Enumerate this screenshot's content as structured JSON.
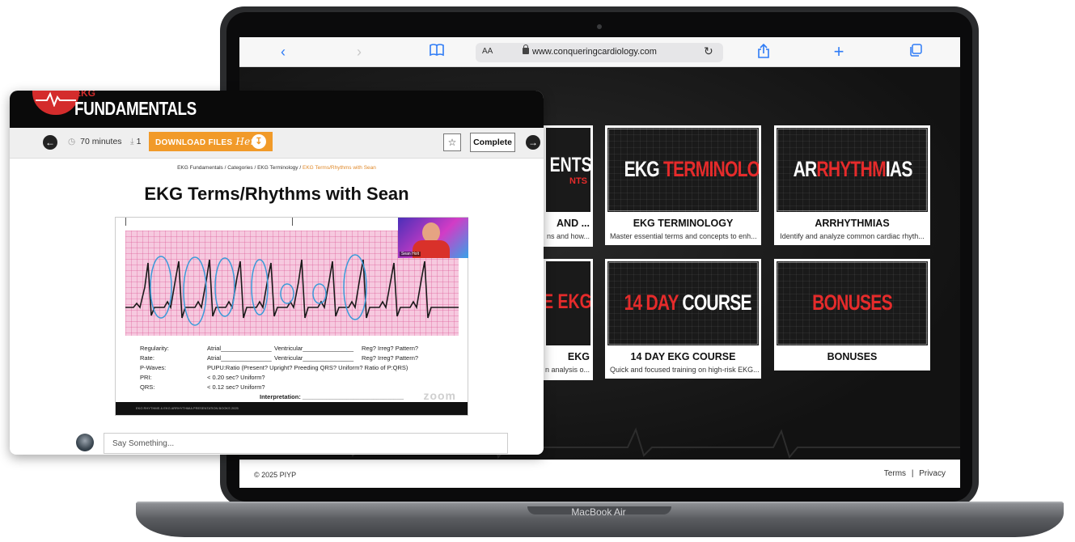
{
  "safari": {
    "text_size": "AA",
    "url": "www.conqueringcardiology.com"
  },
  "courses": {
    "partial_top_thumb": "ENTS",
    "partial_top_thumb_sub": "NTS",
    "partial_top_title": "AND ...",
    "partial_top_desc": "ns and how...",
    "partial_bottom_thumb": "E EKG",
    "partial_bottom_title": "EKG",
    "partial_bottom_desc": "n analysis o...",
    "cards": [
      {
        "thumb_white": "EKG ",
        "thumb_red": "TERMINOLOGY",
        "title": "EKG TERMINOLOGY",
        "desc": "Master essential terms and concepts to enh..."
      },
      {
        "thumb_white": "AR",
        "thumb_red": "RHYTHM",
        "thumb_white2": "IAS",
        "title": "ARRHYTHMIAS",
        "desc": "Identify and analyze common cardiac rhyth..."
      },
      {
        "thumb_red": "14 DAY ",
        "thumb_white": "COURSE",
        "title": "14 DAY EKG COURSE",
        "desc": "Quick and focused training on high-risk EKG..."
      },
      {
        "thumb_red": "BONUSES",
        "title": "BONUSES",
        "desc": ""
      }
    ]
  },
  "footer": {
    "copyright": "© 2025 PIYP",
    "terms": "Terms",
    "sep": "|",
    "privacy": "Privacy"
  },
  "laptop": {
    "model": "MacBook Air"
  },
  "lesson": {
    "logo_top": "EKG",
    "logo_text": "FUNDAMENTALS",
    "duration": "70 minutes",
    "downloads": "1",
    "download_label": "DOWNLOAD FILES",
    "download_here": "Here",
    "complete_label": "Complete",
    "breadcrumb": {
      "a": "EKG Fundamentals",
      "sep": " / ",
      "b": "Categories",
      "c": "EKG Terminology",
      "current": "EKG Terms/Rhythms with Sean"
    },
    "title": "EKG Terms/Rhythms with Sean",
    "webcam_name": "Sean Holt",
    "form": [
      {
        "label": "Regularity:",
        "v1": "Atrial_______________",
        "v2": "Ventricular_______________",
        "v3": "Reg? Irreg? Pattern?"
      },
      {
        "label": "Rate:",
        "v1": "Atrial_______________",
        "v2": "Ventricular_______________",
        "v3": "Reg? Irreg? Pattern?"
      },
      {
        "label": "P-Waves:",
        "v1": "PUPU:Ratio (Present? Upright? Preeding QRS? Uniform? Ratio of P:QRS)",
        "v2": "",
        "v3": ""
      },
      {
        "label": "PRI:",
        "v1": "< 0.20 sec? Uniform?",
        "v2": "",
        "v3": ""
      },
      {
        "label": "QRS:",
        "v1": "< 0.12 sec? Uniform?",
        "v2": "",
        "v3": ""
      }
    ],
    "interpretation": "Interpretation: ______________________________",
    "video_brand": "zoom",
    "video_caption": "EKG RHYTHMS & EKG ARRHYTHMIA PRESENTATION BOOKS 2025",
    "comment_placeholder": "Say Something..."
  }
}
